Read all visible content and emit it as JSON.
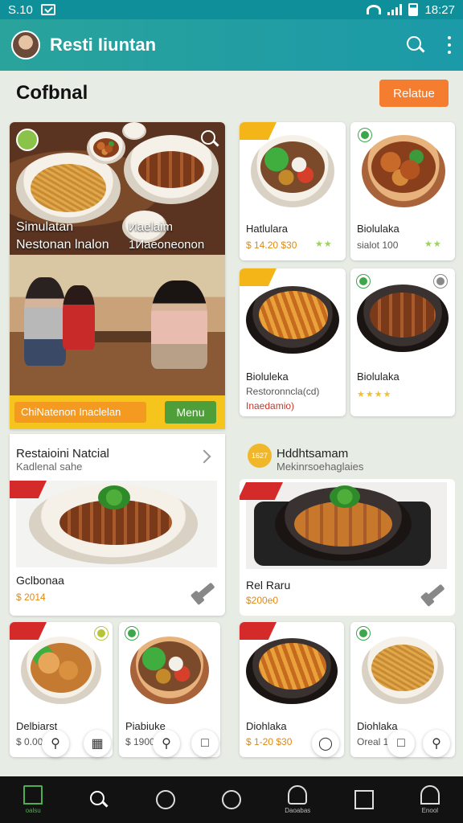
{
  "status_bar": {
    "time": "S.10",
    "right_time": "18:27"
  },
  "app_bar": {
    "title": "Resti Iiuntan"
  },
  "section": {
    "title": "Cofbnal",
    "button": "Relatue"
  },
  "hero": {
    "line1_left": "Simulatan",
    "line2_left": "Nestonan lnalon",
    "line1_right": "Иaelaim",
    "line2_right": "1Иаeoneonon",
    "promo": "ChiNatenon Inaclelan",
    "menu_button": "Menu"
  },
  "tiles_top": [
    {
      "name": "Hatlulara",
      "price": "$ 14.20  $30",
      "rating": "★★"
    },
    {
      "name": "Biolulaka",
      "price": "sialot 100",
      "rating": "★★"
    },
    {
      "name": "Bioluleka",
      "price": "Restoronncla(cd)",
      "note": "Inaedamio)"
    },
    {
      "name": "Biolulaka",
      "price": "",
      "rating": "★★★★"
    }
  ],
  "list_left": {
    "title": "Restaioini Natcial",
    "subtitle": "Kadlenal sahe",
    "dish": "Gclbonaa",
    "price": "$ 2014"
  },
  "list_right": {
    "badge": "1627",
    "title": "Hddhtsamam",
    "subtitle": "Mekinrsoehaglaies",
    "dish": "Rel Raru",
    "price": "$200e0"
  },
  "tiles_bottom": [
    {
      "name": "Delbiarst",
      "price": "$ 0.00"
    },
    {
      "name": "Piabiuke",
      "price": "$ 1900  $0"
    },
    {
      "name": "Diohlaka",
      "price": "$ 1-20  $30"
    },
    {
      "name": "Diohlaka",
      "price": "Oreal 1001"
    }
  ],
  "bottom_nav": [
    {
      "icon": "home-icon",
      "label": "oalsu"
    },
    {
      "icon": "search-icon",
      "label": ""
    },
    {
      "icon": "restaurant-icon",
      "label": ""
    },
    {
      "icon": "circle-icon",
      "label": ""
    },
    {
      "icon": "chef-icon",
      "label": "Daoabas"
    },
    {
      "icon": "square-icon",
      "label": ""
    },
    {
      "icon": "profile-icon",
      "label": "Enool"
    }
  ]
}
